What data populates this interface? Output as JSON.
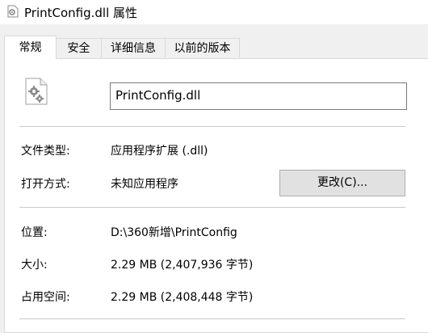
{
  "window": {
    "title": "PrintConfig.dll 属性",
    "icon": "gear-file-icon"
  },
  "tabs": [
    {
      "label": "常规",
      "active": true
    },
    {
      "label": "安全",
      "active": false
    },
    {
      "label": "详细信息",
      "active": false
    },
    {
      "label": "以前的版本",
      "active": false
    }
  ],
  "general": {
    "file_icon": "dll-gear-file-icon",
    "file_name": "PrintConfig.dll",
    "file_type_label": "文件类型:",
    "file_type_value": "应用程序扩展 (.dll)",
    "opens_with_label": "打开方式:",
    "opens_with_value": "未知应用程序",
    "change_button": "更改(C)...",
    "location_label": "位置:",
    "location_value": "D:\\360新增\\PrintConfig",
    "size_label": "大小:",
    "size_value": "2.29 MB (2,407,936 字节)",
    "size_on_disk_label": "占用空间:",
    "size_on_disk_value": "2.29 MB (2,408,448 字节)"
  }
}
